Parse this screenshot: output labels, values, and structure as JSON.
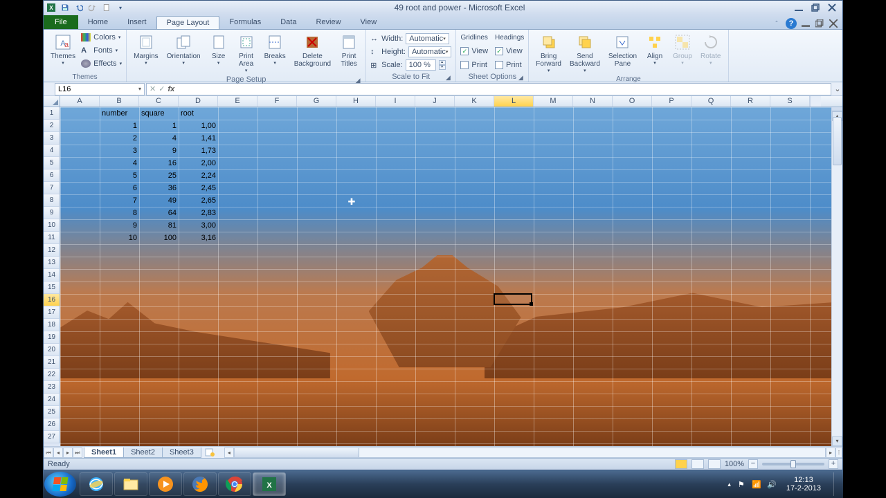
{
  "title": "49 root and power - Microsoft Excel",
  "qat_icons": [
    "excel-icon",
    "save-icon",
    "undo-icon",
    "redo-icon",
    "new-icon",
    "customize-icon"
  ],
  "win_icons": [
    "minimize-icon",
    "restore-icon",
    "close-icon"
  ],
  "tabs": {
    "file": "File",
    "items": [
      "Home",
      "Insert",
      "Page Layout",
      "Formulas",
      "Data",
      "Review",
      "View"
    ],
    "active": "Page Layout"
  },
  "ribbon": {
    "themes": {
      "label": "Themes",
      "btn": "Themes",
      "colors": "Colors",
      "fonts": "Fonts",
      "effects": "Effects"
    },
    "page_setup": {
      "label": "Page Setup",
      "margins": "Margins",
      "orientation": "Orientation",
      "size": "Size",
      "print_area": "Print\nArea",
      "breaks": "Breaks",
      "delete_background": "Delete\nBackground",
      "print_titles": "Print\nTitles"
    },
    "scale": {
      "label": "Scale to Fit",
      "width_lbl": "Width:",
      "width_val": "Automatic",
      "height_lbl": "Height:",
      "height_val": "Automatic",
      "scale_lbl": "Scale:",
      "scale_val": "100 %"
    },
    "sheet_options": {
      "label": "Sheet Options",
      "gridlines": "Gridlines",
      "headings": "Headings",
      "view": "View",
      "print": "Print"
    },
    "arrange": {
      "label": "Arrange",
      "bring_forward": "Bring\nForward",
      "send_backward": "Send\nBackward",
      "selection_pane": "Selection\nPane",
      "align": "Align",
      "group": "Group",
      "rotate": "Rotate"
    }
  },
  "namebox": "L16",
  "formula": "",
  "columns": [
    "A",
    "B",
    "C",
    "D",
    "E",
    "F",
    "G",
    "H",
    "I",
    "J",
    "K",
    "L",
    "M",
    "N",
    "O",
    "P",
    "Q",
    "R",
    "S"
  ],
  "active_col": "L",
  "row_count": 27,
  "active_row": 16,
  "selected_cell": {
    "col": "L",
    "row": 16
  },
  "headers": {
    "B": "number",
    "C": "square",
    "D": "root"
  },
  "data_rows": [
    {
      "row": 2,
      "B": "1",
      "C": "1",
      "D": "1,00"
    },
    {
      "row": 3,
      "B": "2",
      "C": "4",
      "D": "1,41"
    },
    {
      "row": 4,
      "B": "3",
      "C": "9",
      "D": "1,73"
    },
    {
      "row": 5,
      "B": "4",
      "C": "16",
      "D": "2,00"
    },
    {
      "row": 6,
      "B": "5",
      "C": "25",
      "D": "2,24"
    },
    {
      "row": 7,
      "B": "6",
      "C": "36",
      "D": "2,45"
    },
    {
      "row": 8,
      "B": "7",
      "C": "49",
      "D": "2,65"
    },
    {
      "row": 9,
      "B": "8",
      "C": "64",
      "D": "2,83"
    },
    {
      "row": 10,
      "B": "9",
      "C": "81",
      "D": "3,00"
    },
    {
      "row": 11,
      "B": "10",
      "C": "100",
      "D": "3,16"
    }
  ],
  "sheets": {
    "items": [
      "Sheet1",
      "Sheet2",
      "Sheet3"
    ],
    "active": "Sheet1"
  },
  "status": {
    "ready": "Ready",
    "zoom": "100%"
  },
  "taskbar": {
    "time": "12:13",
    "date": "17-2-2013"
  }
}
